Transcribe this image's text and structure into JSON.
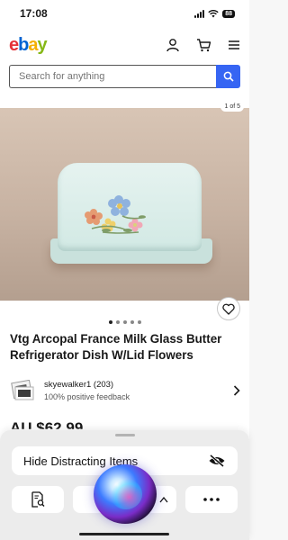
{
  "status_bar": {
    "time": "17:08",
    "battery": "88"
  },
  "header": {
    "logo": {
      "e": "e",
      "b": "b",
      "a": "a",
      "y": "y"
    }
  },
  "search": {
    "placeholder": "Search for anything"
  },
  "listing": {
    "photo_counter": "1 of 5",
    "photo_count": 5,
    "active_photo": 1,
    "title": "Vtg Arcopal France Milk Glass Butter Refrigerator Dish W/Lid Flowers",
    "seller_name": "skyewalker1 (203)",
    "seller_feedback": "100% positive feedback",
    "price": "AU $62.99"
  },
  "sheet": {
    "hide_label": "Hide Distracting Items"
  },
  "icons": {
    "profile": "person-icon",
    "cart": "cart-icon",
    "menu": "hamburger-menu-icon",
    "search": "search-icon",
    "favorite": "heart-icon",
    "chevron": "chevron-right-icon",
    "hide": "eye-slash-icon",
    "summary": "document-search-icon",
    "more": "ellipsis-icon",
    "assistant": "siri-orb-icon"
  },
  "colors": {
    "accent": "#3665f3",
    "ebay_red": "#e53238",
    "ebay_blue": "#0064d2",
    "ebay_yellow": "#f5af02",
    "ebay_green": "#86b817"
  }
}
